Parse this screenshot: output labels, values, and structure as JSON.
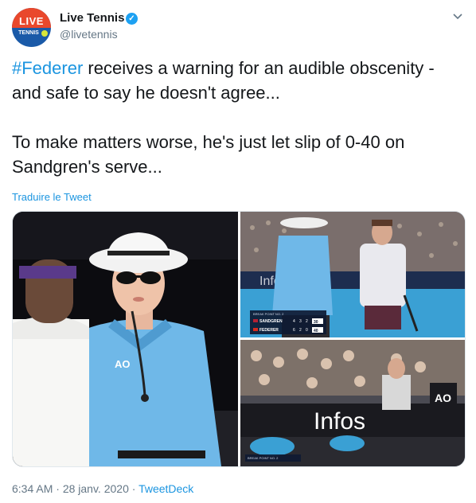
{
  "author": {
    "name": "Live Tennis",
    "handle": "@livetennis",
    "avatar_top_text": "LIVE",
    "avatar_bottom_text": "TENNIS"
  },
  "tweet": {
    "hashtag": "#Federer",
    "line1_rest": " receives a warning for an audible obscenity - and safe to say he doesn't agree...",
    "line2": "To make matters worse, he's just let slip of 0-40 on Sandgren's serve...",
    "translate_label": "Traduire le Tweet"
  },
  "media": {
    "photo1": {
      "shirt_logo": "AO"
    },
    "photo2": {
      "banner_text": "Info",
      "score_title": "BREAK POINT NO. 2",
      "players": [
        {
          "name": "SANDGREN",
          "sets": [
            "4",
            "3",
            "2"
          ],
          "points": "30"
        },
        {
          "name": "FEDERER",
          "sets": [
            "6",
            "2",
            "0"
          ],
          "points": "40"
        }
      ]
    },
    "photo3": {
      "banner_text": "Infos",
      "logo": "AO",
      "score_title": "BREAK POINT NO. 2"
    }
  },
  "footer": {
    "time": "6:34 AM",
    "separator": " · ",
    "date": "28 janv. 2020",
    "source": "TweetDeck"
  },
  "colors": {
    "link": "#1b95e0",
    "secondary_text": "#657786",
    "umpire_shirt": "#6fb8e8"
  }
}
